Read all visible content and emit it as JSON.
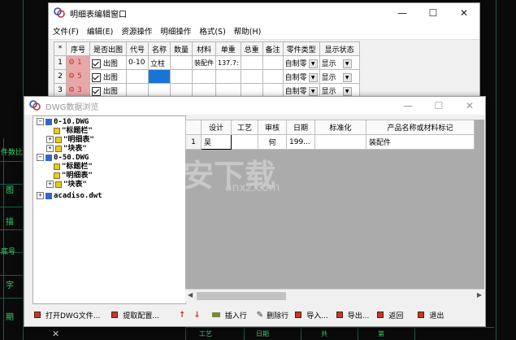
{
  "cad": {
    "labels": [
      "件数比",
      "图",
      "描",
      "底号",
      "字",
      "期"
    ],
    "bottom_labels": [
      "工艺",
      "日期",
      "共",
      "第"
    ]
  },
  "bom_window": {
    "title": "明细表编辑窗口",
    "menu": [
      "文件(F)",
      "编辑(E)",
      "资源操作",
      "明细操作",
      "格式(S)",
      "帮助(H)"
    ],
    "columns": [
      "*",
      "序号",
      "是否出图",
      "代号",
      "名称",
      "数量",
      "材料",
      "单重",
      "总重",
      "备注",
      "零件类型",
      "显示状态"
    ],
    "rows": [
      {
        "rn": "1",
        "seq": "1",
        "out": "出图",
        "code": "0-10",
        "name": "立柱",
        "qty": "",
        "material": "装配件",
        "unit_weight": "137.7:",
        "total": "",
        "note": "",
        "type": "自制零",
        "status": "显示"
      },
      {
        "rn": "2",
        "seq": "5",
        "out": "出图",
        "code": "",
        "name": "",
        "qty": "",
        "material": "",
        "unit_weight": "",
        "total": "",
        "note": "",
        "type": "自制零",
        "status": "显示"
      },
      {
        "rn": "3",
        "seq": "3",
        "out": "出图",
        "code": "",
        "name": "",
        "qty": "",
        "material": "",
        "unit_weight": "",
        "total": "",
        "note": "",
        "type": "自制零",
        "status": "显示"
      }
    ]
  },
  "dwg_window": {
    "title": "DWG数据浏览",
    "tree": [
      {
        "label": "0-10.DWG",
        "level": 0,
        "kind": "file",
        "expander": "−"
      },
      {
        "label": "\"标题栏\"",
        "level": 1,
        "kind": "table",
        "expander": ""
      },
      {
        "label": "\"明细表\"",
        "level": 1,
        "kind": "table",
        "expander": "+"
      },
      {
        "label": "\"块表\"",
        "level": 1,
        "kind": "table",
        "expander": "+"
      },
      {
        "label": "0-50.DWG",
        "level": 0,
        "kind": "file",
        "expander": "−"
      },
      {
        "label": "\"标题栏\"",
        "level": 1,
        "kind": "table",
        "expander": ""
      },
      {
        "label": "\"明细表\"",
        "level": 1,
        "kind": "table",
        "expander": ""
      },
      {
        "label": "\"块表\"",
        "level": 1,
        "kind": "table",
        "expander": "+"
      },
      {
        "label": "acadiso.dwt",
        "level": 0,
        "kind": "file",
        "expander": "+"
      }
    ],
    "grid_columns": [
      "",
      "设计",
      "工艺",
      "审核",
      "日期",
      "标准化",
      "产品名称或材料标记"
    ],
    "grid_rows": [
      [
        "1",
        "吴",
        "",
        "何",
        "199...",
        "",
        "装配件"
      ]
    ],
    "toolbar": {
      "open": "打开DWG文件...",
      "config": "提取配置...",
      "up": "↑",
      "down": "↓",
      "insert": "插入行",
      "delete": "删除行",
      "import": "导入...",
      "export": "导出...",
      "back": "返回",
      "exit": "退出"
    }
  },
  "watermark": {
    "main": "安下载",
    "sub": "anxz.com"
  }
}
